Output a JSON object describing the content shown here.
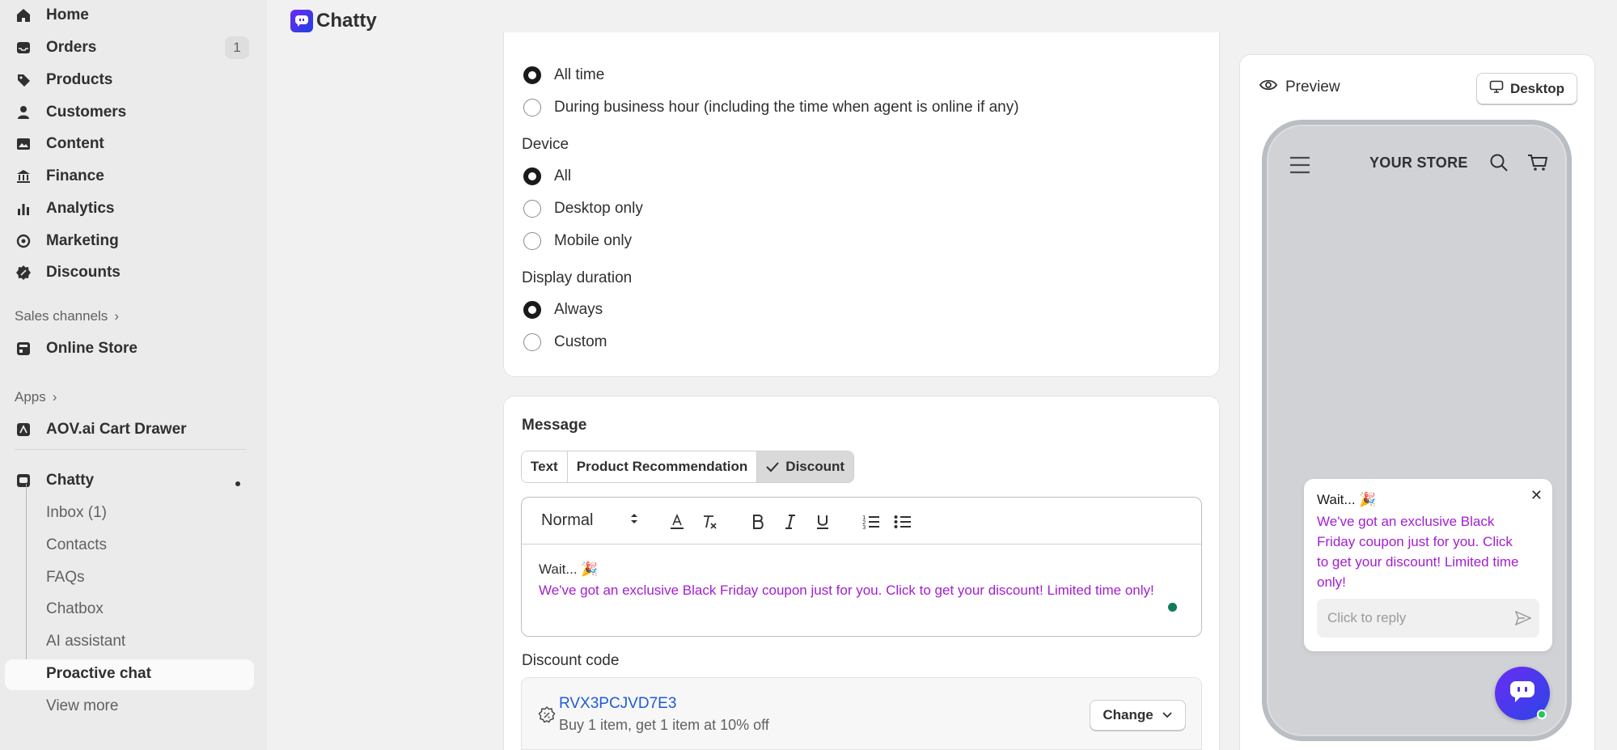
{
  "sidebar": {
    "nav": [
      {
        "label": "Home",
        "icon": "home-icon"
      },
      {
        "label": "Orders",
        "icon": "inbox-tray-icon",
        "badge": "1"
      },
      {
        "label": "Products",
        "icon": "tag-icon"
      },
      {
        "label": "Customers",
        "icon": "person-icon"
      },
      {
        "label": "Content",
        "icon": "image-icon"
      },
      {
        "label": "Finance",
        "icon": "bank-icon"
      },
      {
        "label": "Analytics",
        "icon": "bar-chart-icon"
      },
      {
        "label": "Marketing",
        "icon": "target-icon"
      },
      {
        "label": "Discounts",
        "icon": "discount-icon"
      }
    ],
    "sales_channels_label": "Sales channels",
    "online_store": "Online Store",
    "apps_label": "Apps",
    "aov_app": "AOV.ai Cart Drawer",
    "chatty_app": "Chatty",
    "chatty_sub": [
      "Inbox (1)",
      "Contacts",
      "FAQs",
      "Chatbox",
      "AI assistant",
      "Proactive chat",
      "View more"
    ]
  },
  "header": {
    "title": "Chatty"
  },
  "settings": {
    "time_options": [
      "All time",
      "During business hour (including the time when agent is online if any)"
    ],
    "device_label": "Device",
    "device_options": [
      "All",
      "Desktop only",
      "Mobile only"
    ],
    "duration_label": "Display duration",
    "duration_options": [
      "Always",
      "Custom"
    ]
  },
  "message": {
    "title": "Message",
    "tabs": [
      "Text",
      "Product Recommendation",
      "Discount"
    ],
    "format_select": "Normal",
    "line1": "Wait... 🎉",
    "line2": "We've got an exclusive Black Friday coupon just for you. Click to get your discount! Limited time only!"
  },
  "discount": {
    "label": "Discount code",
    "code": "RVX3PCJVD7E3",
    "description": "Buy 1 item, get 1 item at 10% off",
    "change_label": "Change"
  },
  "preview": {
    "label": "Preview",
    "desktop_label": "Desktop",
    "store_name": "YOUR STORE",
    "popup_title": "Wait... 🎉",
    "popup_text": "We've got an exclusive Black Friday coupon just for you. Click to get your discount! Limited time only!",
    "reply_placeholder": "Click to reply"
  },
  "colors": {
    "accent_purple": "#a21fcf",
    "link_blue": "#1f5bd6",
    "brand_gradient": "#6b2cf5"
  }
}
